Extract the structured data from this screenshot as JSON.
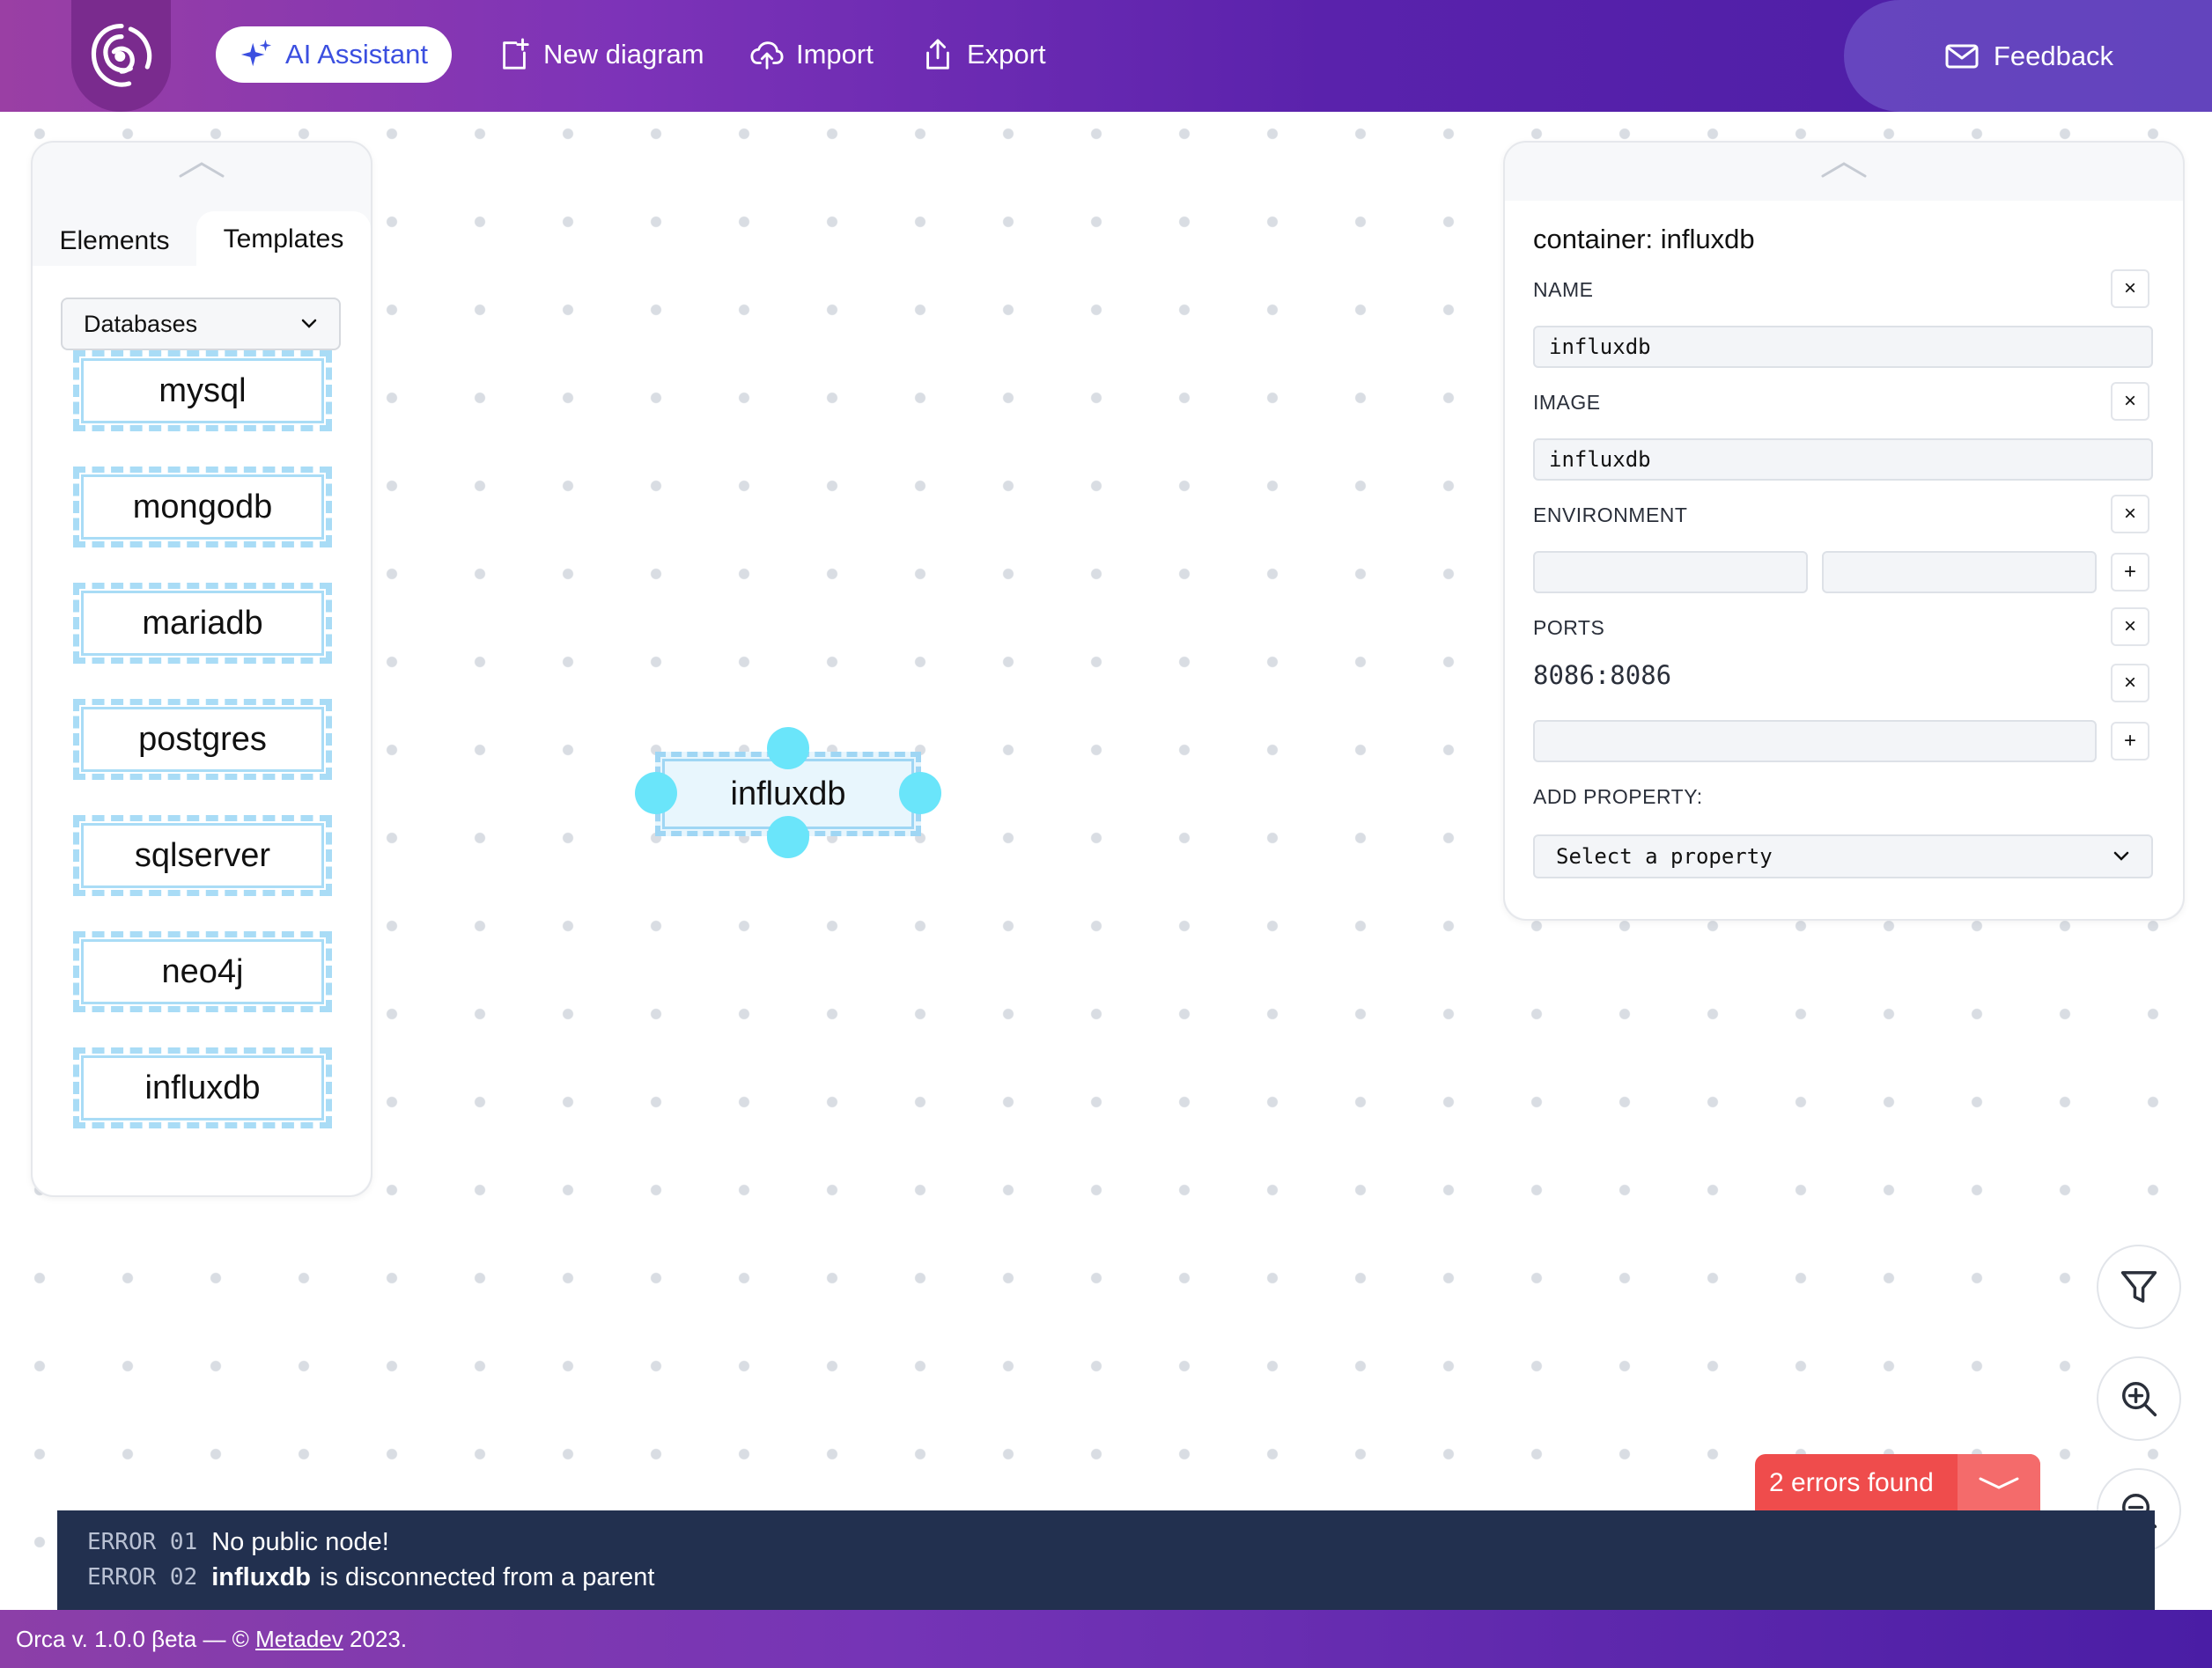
{
  "header": {
    "ai_assistant": "AI Assistant",
    "new_diagram": "New diagram",
    "import": "Import",
    "export": "Export",
    "feedback": "Feedback"
  },
  "left_panel": {
    "tabs": [
      "Elements",
      "Templates"
    ],
    "active_tab": "Templates",
    "category": "Databases",
    "templates": [
      "mysql",
      "mongodb",
      "mariadb",
      "postgres",
      "sqlserver",
      "neo4j",
      "influxdb"
    ]
  },
  "canvas": {
    "node_label": "influxdb"
  },
  "properties": {
    "title": "container: influxdb",
    "name_label": "NAME",
    "name_value": "influxdb",
    "image_label": "IMAGE",
    "image_value": "influxdb",
    "environment_label": "ENVIRONMENT",
    "env_key": "",
    "env_value": "",
    "ports_label": "PORTS",
    "ports": [
      "8086:8086"
    ],
    "new_port": "",
    "add_property_label": "ADD PROPERTY:",
    "add_property_select": "Select a property",
    "remove_glyph": "×",
    "add_glyph": "+"
  },
  "errors": {
    "summary": "2 errors found",
    "items": [
      {
        "code": "ERROR 01",
        "bold": "",
        "text": "No public node!"
      },
      {
        "code": "ERROR 02",
        "bold": "influxdb",
        "text": "is disconnected from a parent"
      }
    ]
  },
  "footer": {
    "prefix": "Orca v. 1.0.0 βeta — ©",
    "link": "Metadev",
    "year": "2023."
  },
  "colors": {
    "header_start": "#9a3fa4",
    "header_end": "#4a1da5",
    "accent_blue": "#3b4fe0",
    "node_border": "#9fd6f4",
    "node_handle": "#6ae5fa",
    "error_red": "#ef4c4c",
    "error_panel": "#22304f"
  },
  "icons": {
    "logo": "orca-logo-icon",
    "ai": "sparkles-icon",
    "new": "new-file-icon",
    "import": "cloud-upload-icon",
    "export": "share-upload-icon",
    "feedback": "mail-icon",
    "filter": "filter-icon",
    "zoom_in": "zoom-in-icon",
    "zoom_out": "zoom-out-icon"
  }
}
